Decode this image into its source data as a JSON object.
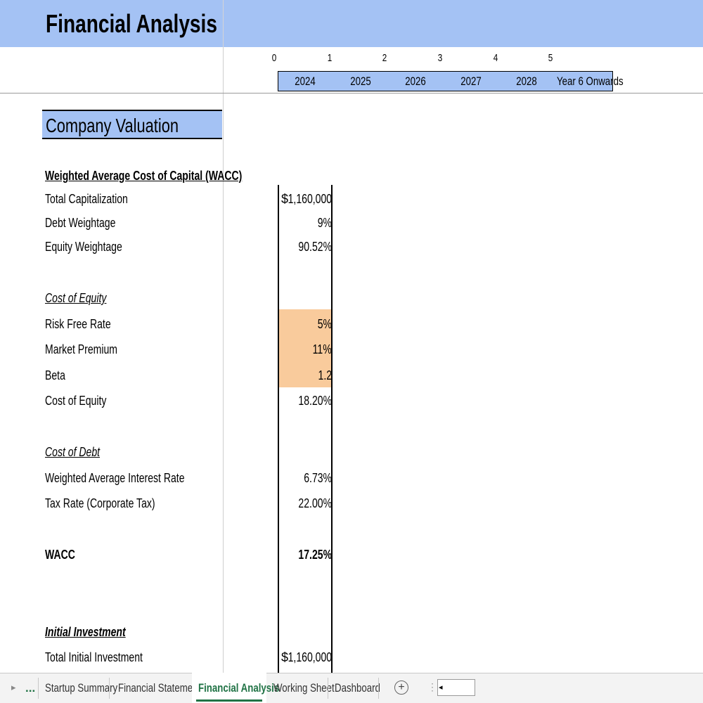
{
  "sheet_title": "Financial Analysis",
  "period_index": [
    "0",
    "1",
    "2",
    "3",
    "4",
    "5"
  ],
  "years": [
    "2024",
    "2025",
    "2026",
    "2027",
    "2028",
    "Year 6 Onwards"
  ],
  "section_title": "Company Valuation",
  "wacc_heading": "Weighted Average Cost of Capital (WACC)",
  "rows": {
    "total_capitalization": {
      "label": "Total Capitalization",
      "currency": "$",
      "value": "1,160,000"
    },
    "debt_weightage": {
      "label": "Debt Weightage",
      "value": "9%"
    },
    "equity_weightage": {
      "label": "Equity Weightage",
      "value": "90.52%"
    },
    "cost_of_equity_heading": {
      "label": "Cost of Equity"
    },
    "risk_free_rate": {
      "label": "Risk Free Rate",
      "value": "5%"
    },
    "market_premium": {
      "label": "Market Premium",
      "value": "11%"
    },
    "beta": {
      "label": "Beta",
      "value": "1.2"
    },
    "cost_of_equity": {
      "label": "Cost of Equity",
      "value": "18.20%"
    },
    "cost_of_debt_heading": {
      "label": "Cost of Debt"
    },
    "weighted_avg_interest_rate": {
      "label": "Weighted Average Interest Rate",
      "value": "6.73%"
    },
    "tax_rate": {
      "label": "Tax Rate (Corporate Tax)",
      "value": "22.00%"
    },
    "wacc": {
      "label": "WACC",
      "value": "17.25%"
    },
    "initial_investment_heading": {
      "label": "Initial Investment"
    },
    "total_initial_investment": {
      "label": "Total Initial Investment",
      "currency": "$",
      "value": "1,160,000"
    }
  },
  "tabs": {
    "more": "...",
    "items": [
      "Startup Summary",
      "Financial Statements",
      "Financial Analysis",
      "Working Sheet",
      "Dashboard"
    ],
    "active": "Financial Analysis"
  },
  "colors": {
    "header_fill": "#a4c2f4",
    "input_fill": "#f9cb9c",
    "active_tab_accent": "#217346"
  },
  "icons": {
    "tab_nav_right": "chevron-right-icon",
    "add_sheet": "plus-circle-icon",
    "scroll_left": "scroll-left-arrow-icon"
  }
}
